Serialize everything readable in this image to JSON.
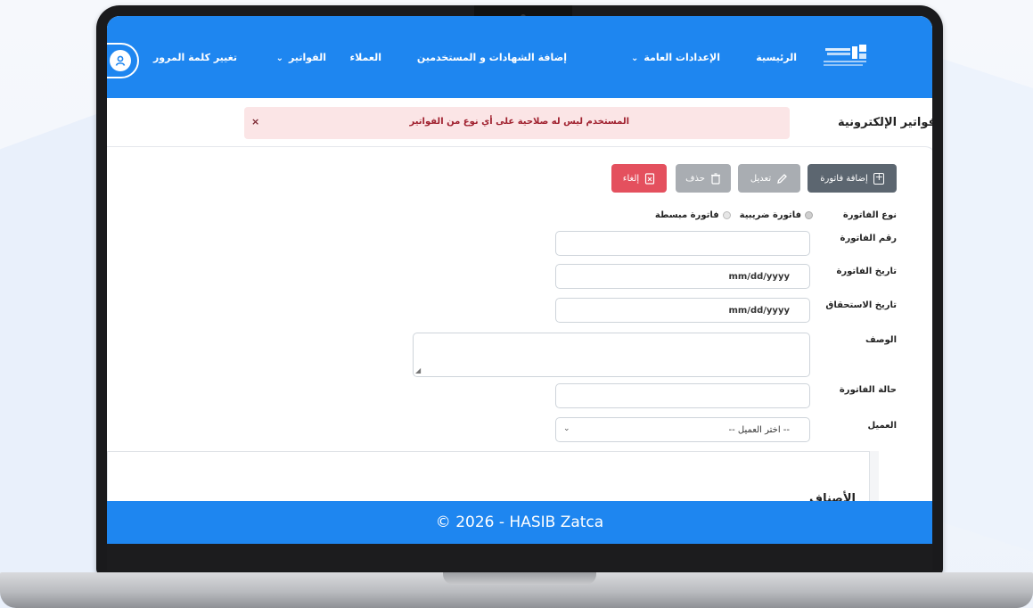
{
  "navbar": {
    "items": [
      {
        "label": "الرئيسية"
      },
      {
        "label": "الإعدادات العامة"
      },
      {
        "label": "إضافة الشهادات و المستخدمين"
      },
      {
        "label": "العملاء"
      },
      {
        "label": "الفواتير"
      },
      {
        "label": "تغيير كلمة المرور"
      }
    ],
    "dropdown_chevron": "⌄"
  },
  "page": {
    "title": "فواتير الإلكترونية"
  },
  "alert": {
    "message": "المستخدم ليس له صلاحية على أي نوع من الفواتير",
    "close": "×"
  },
  "toolbar": {
    "add_label": "إضافة فاتورة",
    "edit_label": "تعديل",
    "delete_label": "حذف",
    "cancel_label": "إلغاء"
  },
  "form": {
    "invoice_type_label": "نوع الفاتورة",
    "invoice_type_options": [
      "فاتورة ضريبية",
      "فاتورة مبسطة"
    ],
    "invoice_number_label": "رقم الفاتورة",
    "invoice_date_label": "تاريخ الفاتورة",
    "invoice_date_value": "mm/dd/yyyy",
    "due_date_label": "تاريخ الاستحقاق",
    "due_date_value": "mm/dd/yyyy",
    "description_label": "الوصف",
    "status_label": "حالة الفاتورة",
    "customer_label": "العميل",
    "customer_selected": "-- اختر العميل --"
  },
  "items": {
    "title": "الأصناف"
  },
  "footer": {
    "text": "© 2026 - HASIB Zatca"
  },
  "colors": {
    "brand": "#1e86f0",
    "alert_bg": "#fbe5e6",
    "cancel": "#e4505e",
    "add": "#5c6670"
  }
}
